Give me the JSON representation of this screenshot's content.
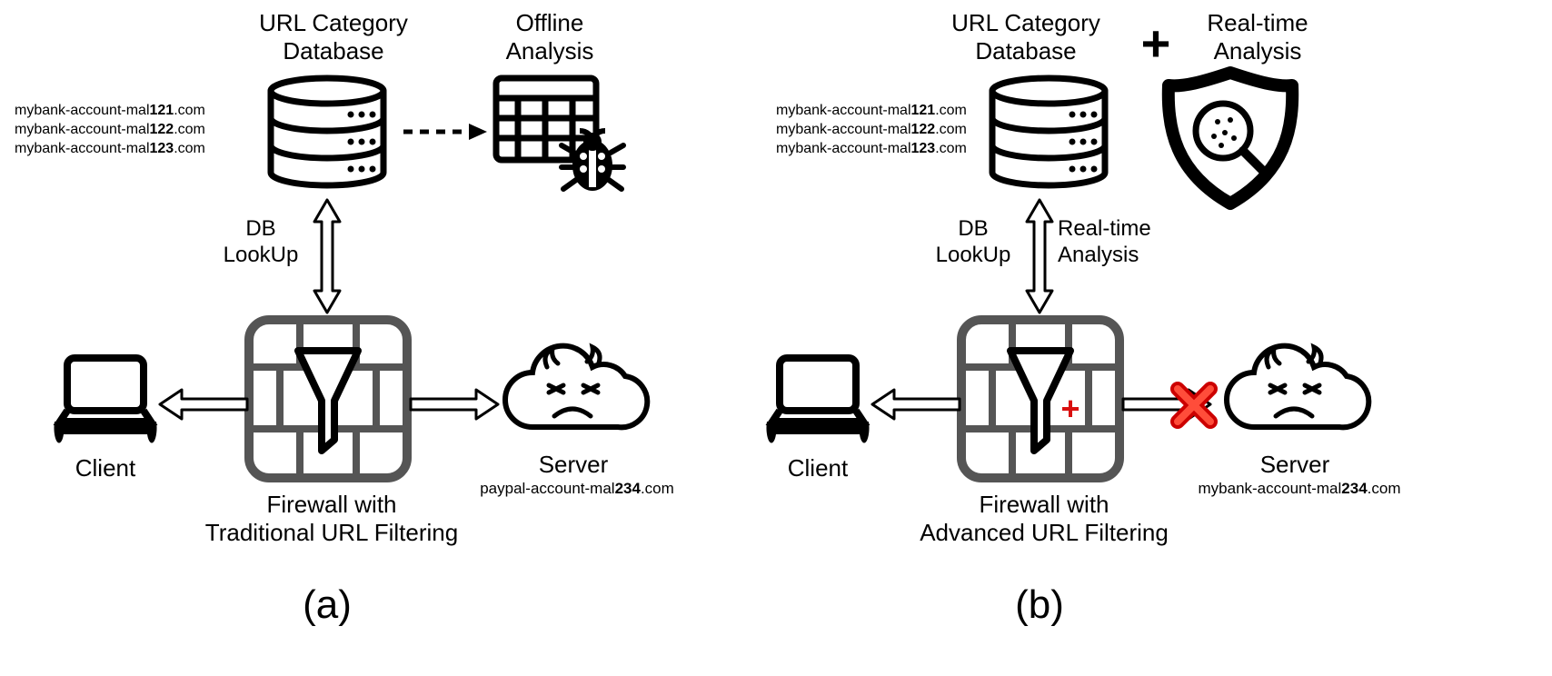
{
  "a": {
    "header_db": "URL Category\nDatabase",
    "header_offline": "Offline\nAnalysis",
    "urls_prefix": "mybank-account-mal",
    "urls_suffix": ".com",
    "urls_bold": [
      "121",
      "122",
      "123"
    ],
    "link_label": "DB\nLookUp",
    "client": "Client",
    "server": "Server",
    "server_url_prefix": "paypal-account-mal",
    "server_url_bold": "234",
    "server_url_suffix": ".com",
    "fw_caption": "Firewall with\nTraditional URL Filtering",
    "tag": "(a)"
  },
  "b": {
    "header_db": "URL Category\nDatabase",
    "plus": "+",
    "header_rt": "Real-time\nAnalysis",
    "urls_prefix": "mybank-account-mal",
    "urls_suffix": ".com",
    "urls_bold": [
      "121",
      "122",
      "123"
    ],
    "link_left": "DB\nLookUp",
    "link_right": "Real-time\nAnalysis",
    "client": "Client",
    "server": "Server",
    "server_url_prefix": "mybank-account-mal",
    "server_url_bold": "234",
    "server_url_suffix": ".com",
    "fw_caption": "Firewall with\nAdvanced URL Filtering",
    "tag": "(b)",
    "plus_red": "+",
    "block_x": "✖"
  }
}
